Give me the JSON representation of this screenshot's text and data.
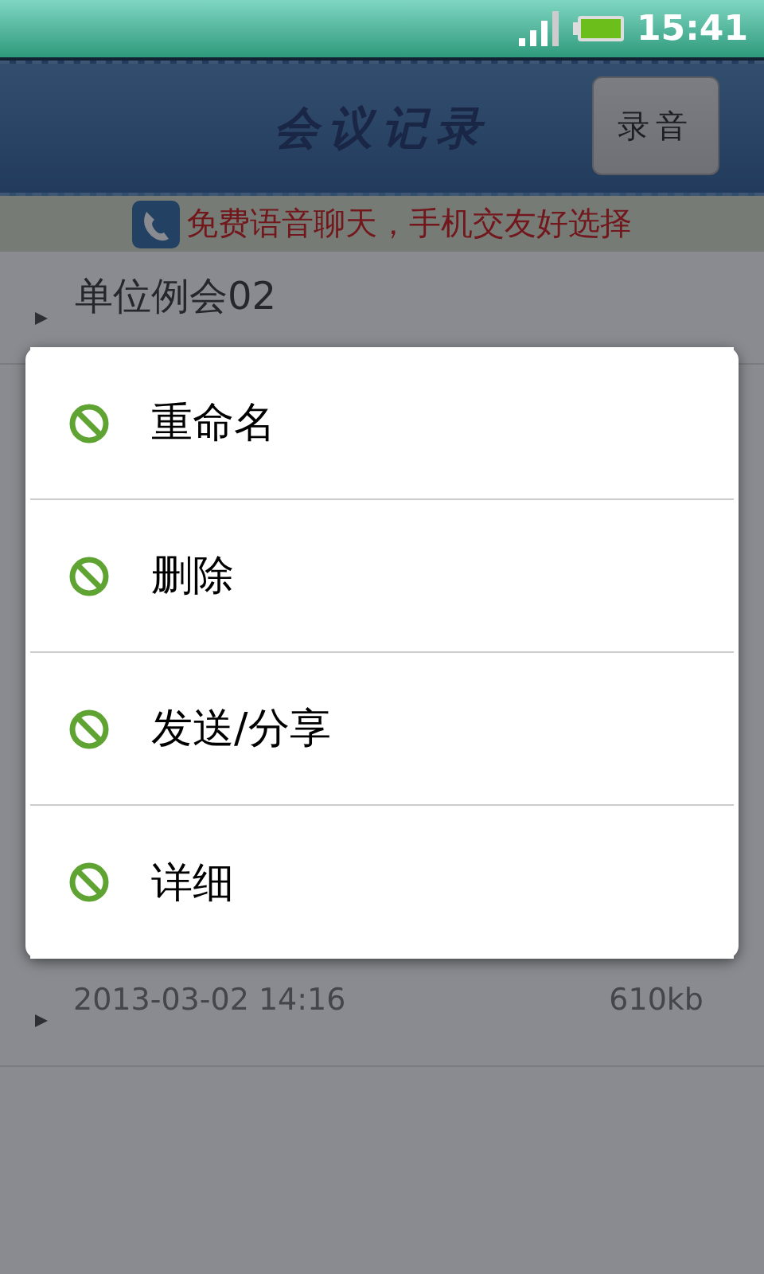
{
  "status_bar": {
    "time": "15:41"
  },
  "header": {
    "title": "会议记录",
    "record_button": "录音"
  },
  "banner": {
    "text": "免费语音聊天，手机交友好选择"
  },
  "recordings": [
    {
      "title": "单位例会02"
    },
    {
      "date": "2013-03-02  14:16",
      "size": "610kb"
    }
  ],
  "menu": {
    "items": [
      {
        "label": "重命名"
      },
      {
        "label": "删除"
      },
      {
        "label": "发送/分享"
      },
      {
        "label": "详细"
      }
    ]
  }
}
